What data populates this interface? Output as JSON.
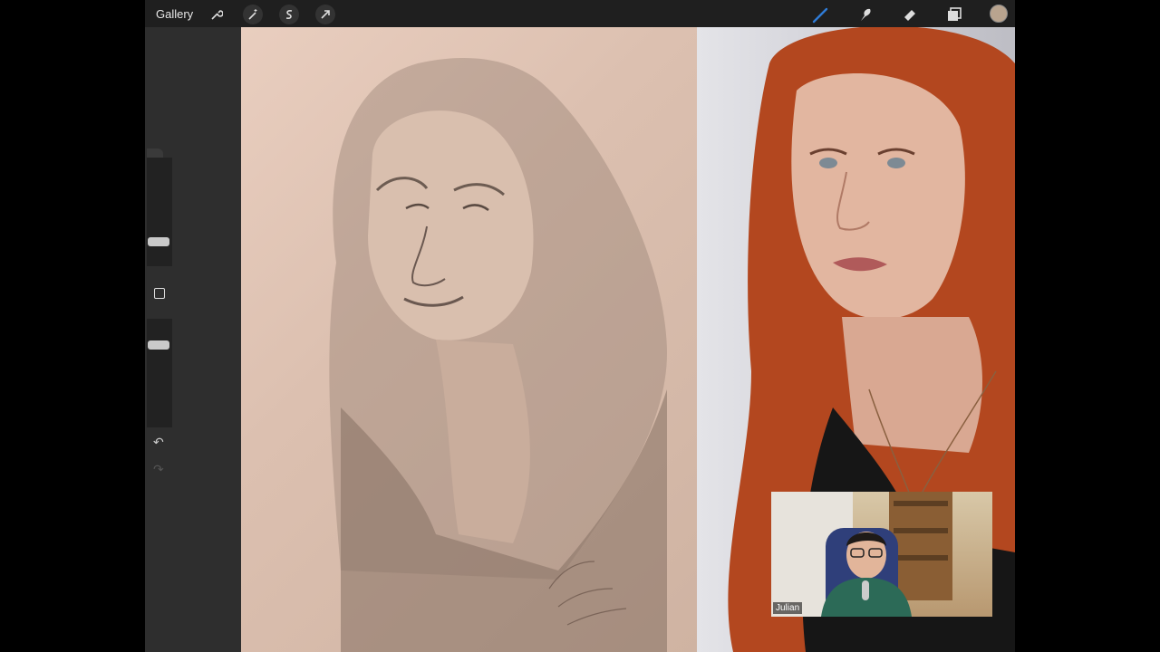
{
  "toolbar": {
    "gallery_label": "Gallery",
    "left_tools": [
      "wrench-icon",
      "magic-wand-icon",
      "selection-icon",
      "transform-arrow-icon"
    ],
    "right_tools": [
      "brush-icon",
      "smudge-icon",
      "eraser-icon",
      "layers-icon",
      "color-swatch-icon"
    ],
    "brush_color": "#2f7bd6",
    "swatch_color": "#b9a48f"
  },
  "video_overlay": {
    "participant_name": "Julian"
  }
}
